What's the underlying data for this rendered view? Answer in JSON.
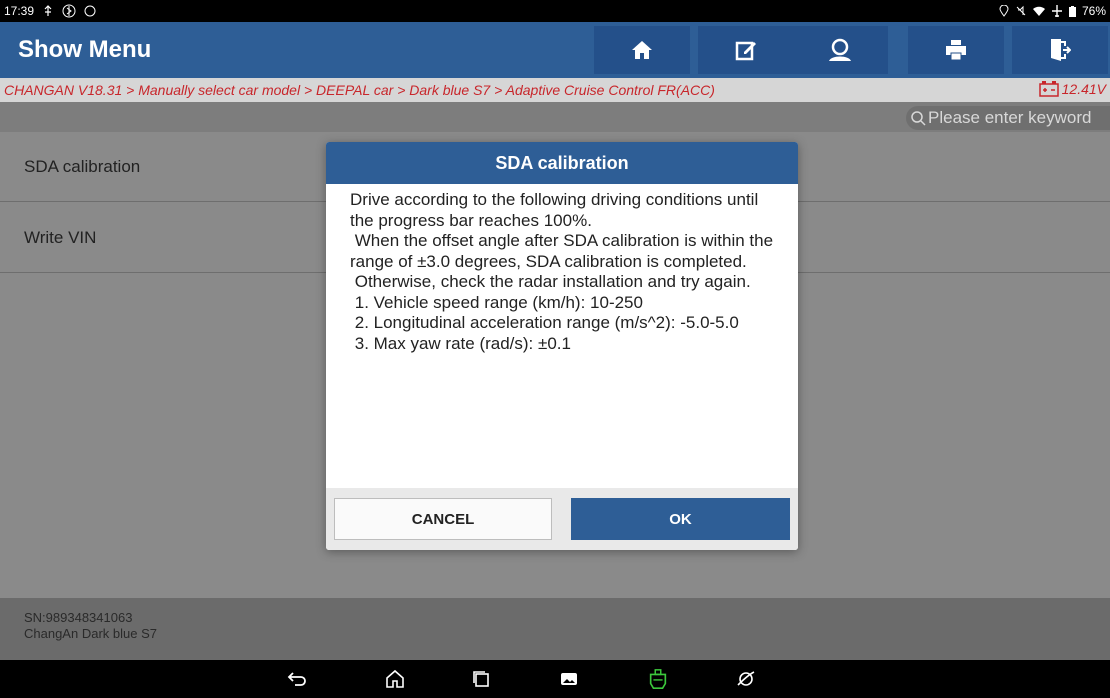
{
  "status_bar": {
    "time": "17:39",
    "battery": "76%"
  },
  "toolbar": {
    "title": "Show Menu",
    "buttons": [
      "home-icon",
      "edit-icon",
      "user-icon",
      "print-icon",
      "exit-icon"
    ]
  },
  "breadcrumb": {
    "path": "CHANGAN V18.31 > Manually select car model > DEEPAL car > Dark blue S7 > Adaptive Cruise Control FR(ACC)",
    "voltage": "12.41V"
  },
  "search": {
    "placeholder": "Please enter keyword"
  },
  "list": {
    "items": [
      "SDA calibration",
      "Write VIN"
    ]
  },
  "dialog": {
    "title": "SDA calibration",
    "body": "Drive according to the following driving conditions until the progress bar reaches 100%.\n When the offset angle after SDA calibration is within the range of ±3.0 degrees, SDA calibration is completed.\n Otherwise, check the radar installation and try again.\n 1. Vehicle speed range (km/h): 10-250\n 2. Longitudinal acceleration range (m/s^2): -5.0-5.0\n 3. Max yaw rate (rad/s): ±0.1",
    "cancel_label": "CANCEL",
    "ok_label": "OK"
  },
  "footer": {
    "sn": "SN:989348341063",
    "vehicle": "ChangAn Dark blue S7"
  },
  "colors": {
    "primary": "#2e5e96",
    "breadcrumb_text": "#c8262b",
    "vci_icon": "#3cc83c"
  }
}
